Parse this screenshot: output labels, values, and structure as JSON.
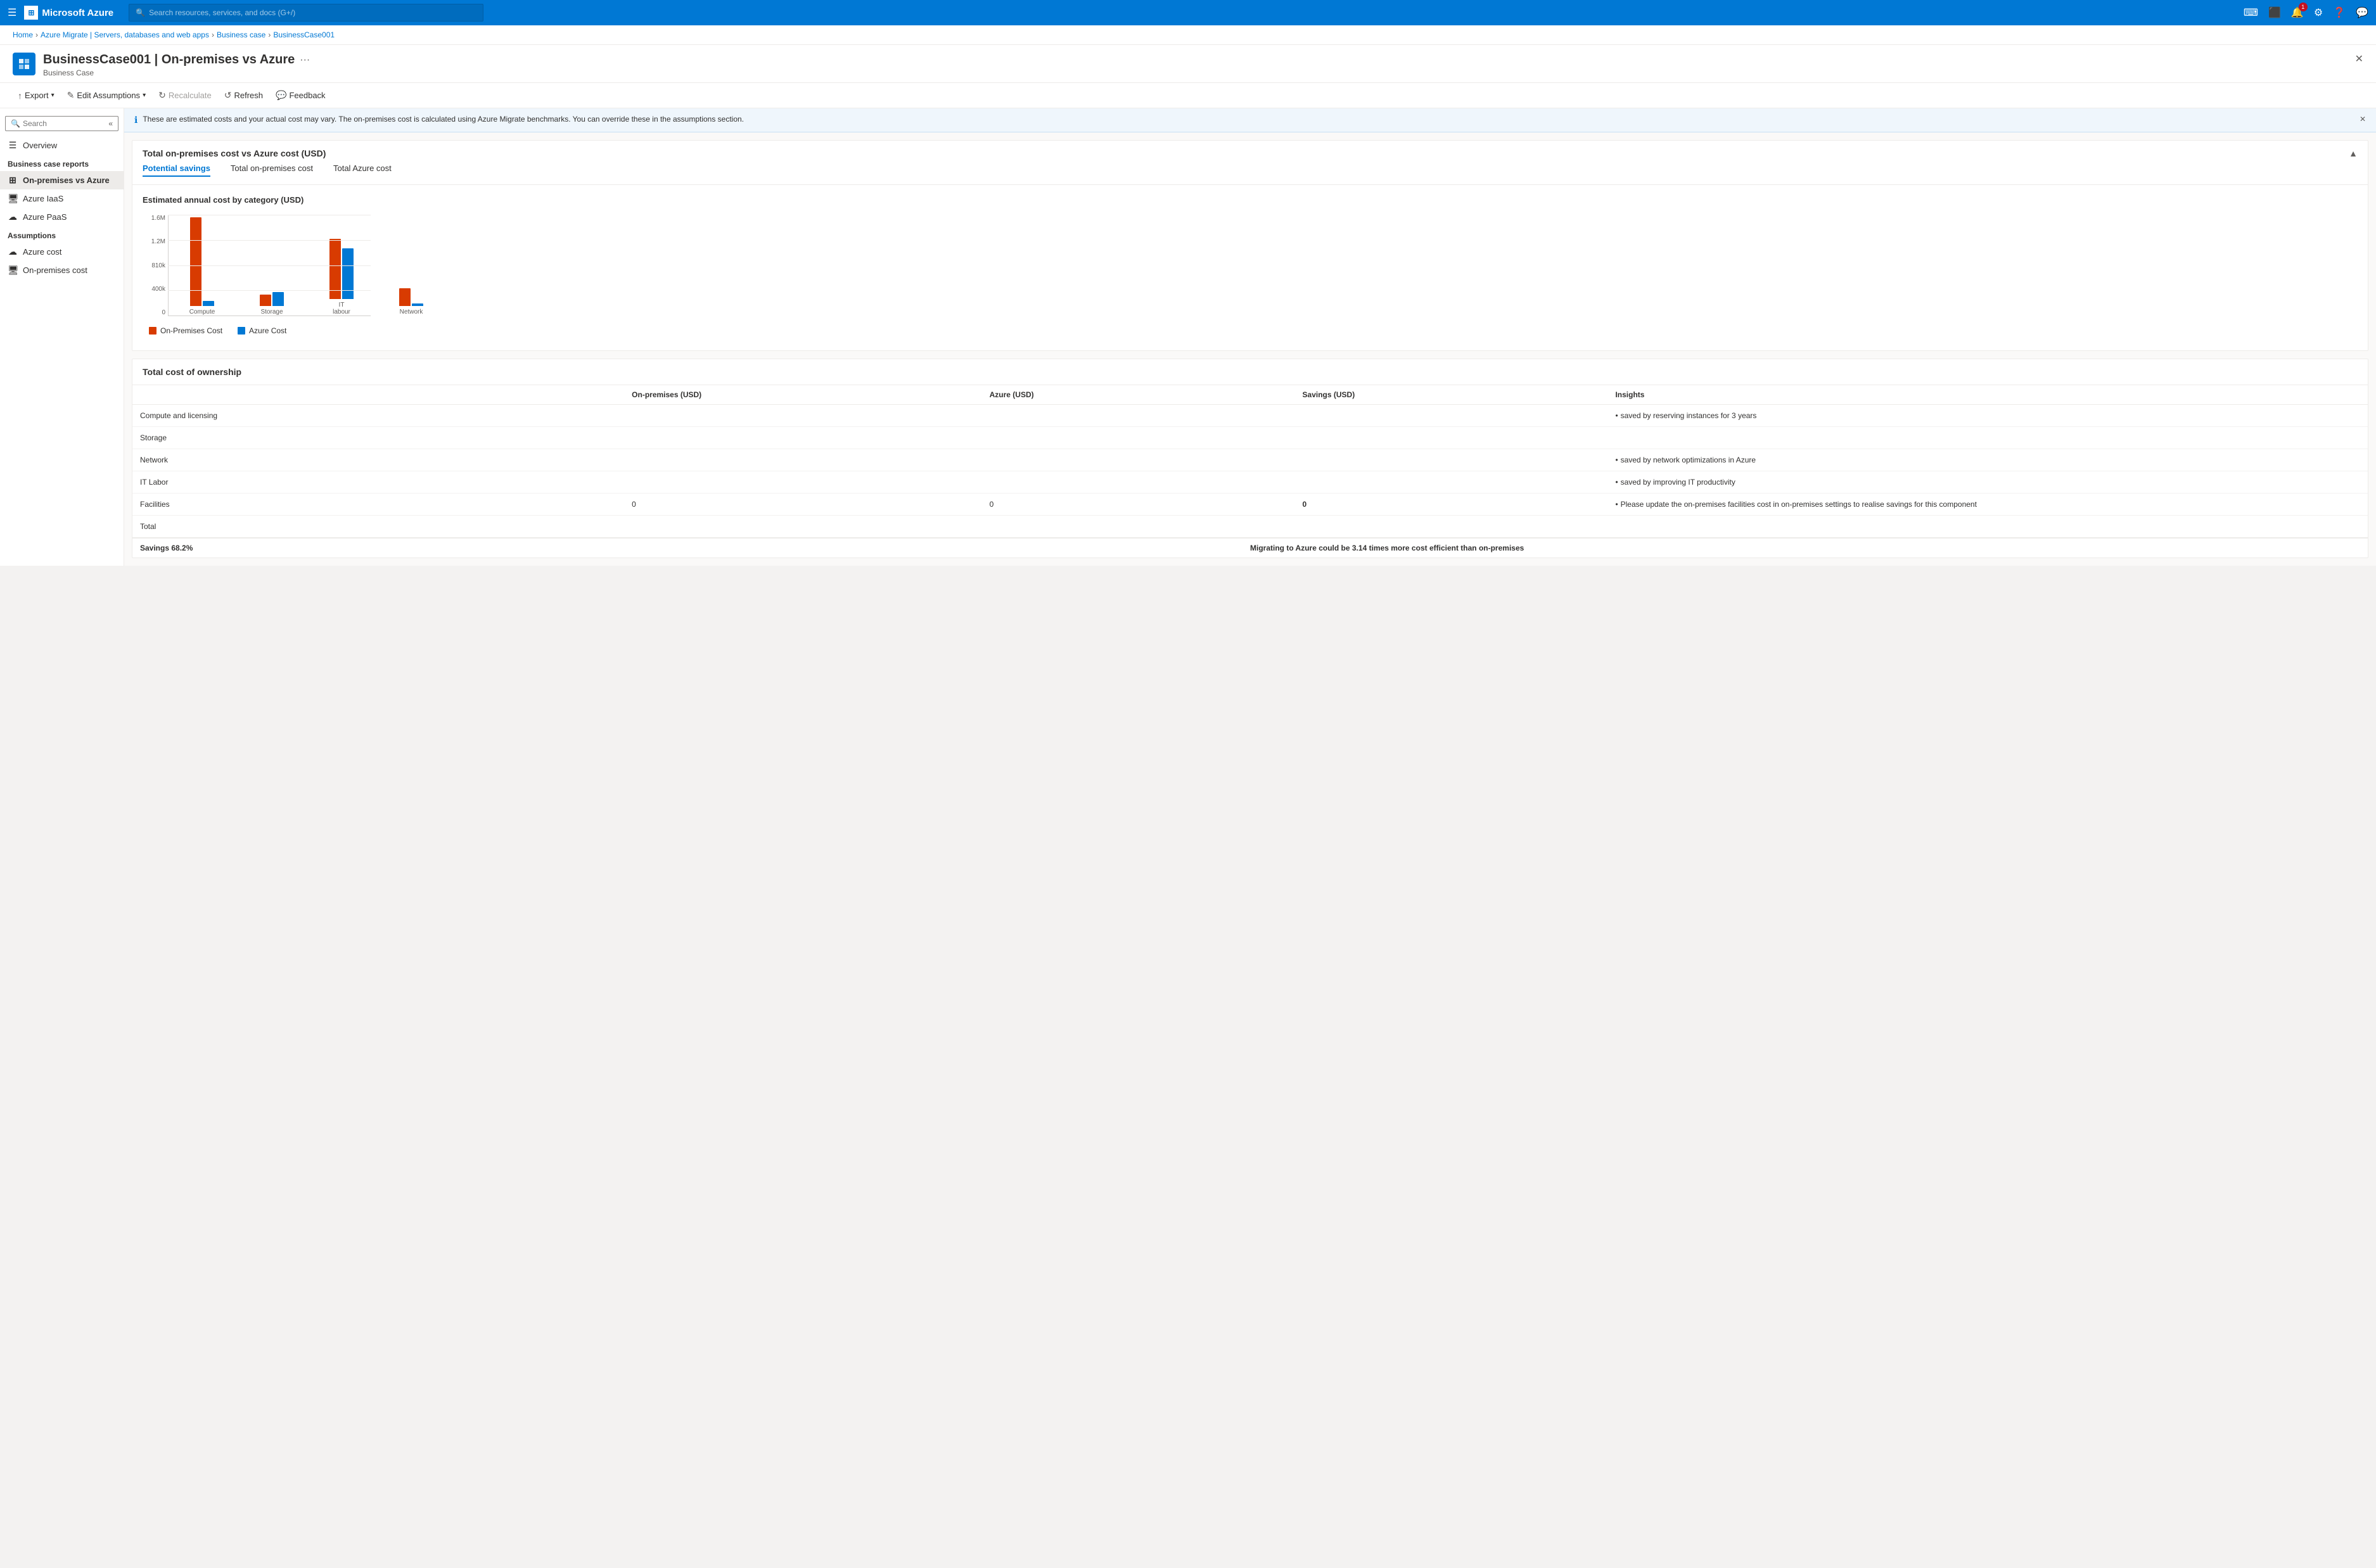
{
  "topBar": {
    "hamburger": "☰",
    "logo": "Microsoft Azure",
    "searchPlaceholder": "Search resources, services, and docs (G+/)",
    "icons": [
      "🖥",
      "⬆",
      "🔔",
      "⚙",
      "❓",
      "💬"
    ],
    "notificationBadge": "1"
  },
  "breadcrumb": {
    "items": [
      "Home",
      "Azure Migrate | Servers, databases and web apps",
      "Business case",
      "BusinessCase001"
    ]
  },
  "pageHeader": {
    "title": "BusinessCase001 | On-premises vs Azure",
    "subtitle": "Business Case",
    "icon": "📊"
  },
  "toolbar": {
    "export": "Export",
    "editAssumptions": "Edit Assumptions",
    "recalculate": "Recalculate",
    "refresh": "Refresh",
    "feedback": "Feedback"
  },
  "sidebar": {
    "searchPlaceholder": "Search",
    "overview": "Overview",
    "businessCaseReportsLabel": "Business case reports",
    "reports": [
      {
        "label": "On-premises vs Azure",
        "active": true
      },
      {
        "label": "Azure IaaS"
      },
      {
        "label": "Azure PaaS"
      }
    ],
    "assumptionsLabel": "Assumptions",
    "assumptions": [
      {
        "label": "Azure cost"
      },
      {
        "label": "On-premises cost"
      }
    ]
  },
  "infoBanner": {
    "text": "These are estimated costs and your actual cost may vary. The on-premises cost is calculated using Azure Migrate benchmarks. You can override these in the assumptions section."
  },
  "costSection": {
    "title": "Total on-premises cost vs Azure cost (USD)",
    "tabs": [
      "Potential savings",
      "Total on-premises cost",
      "Total Azure cost"
    ],
    "activeTab": 0
  },
  "chart": {
    "title": "Estimated annual cost by category (USD)",
    "yLabels": [
      "0",
      "400k",
      "810k",
      "1.2M",
      "1.6M"
    ],
    "groups": [
      {
        "label": "Compute",
        "onPremHeight": 140,
        "azureHeight": 8
      },
      {
        "label": "Storage",
        "onPremHeight": 18,
        "azureHeight": 22
      },
      {
        "label": "IT labour",
        "onPremHeight": 95,
        "azureHeight": 80
      },
      {
        "label": "Network",
        "onPremHeight": 28,
        "azureHeight": 4
      }
    ],
    "legend": {
      "onPremLabel": "On-Premises Cost",
      "azureLabel": "Azure Cost"
    }
  },
  "tcoSection": {
    "title": "Total cost of ownership",
    "headers": [
      "",
      "On-premises (USD)",
      "Azure (USD)",
      "Savings (USD)",
      "Insights"
    ],
    "rows": [
      {
        "category": "Compute and licensing",
        "onPrem": "",
        "azure": "",
        "savings": "",
        "insight": "saved by reserving instances for 3 years"
      },
      {
        "category": "Storage",
        "onPrem": "",
        "azure": "",
        "savings": "",
        "insight": ""
      },
      {
        "category": "Network",
        "onPrem": "",
        "azure": "",
        "savings": "",
        "insight": "saved by network optimizations in Azure"
      },
      {
        "category": "IT Labor",
        "onPrem": "",
        "azure": "",
        "savings": "",
        "insight": "saved by improving IT productivity"
      },
      {
        "category": "Facilities",
        "onPrem": "0",
        "azure": "0",
        "savings": "0",
        "insight": "Please update the on-premises facilities cost in on-premises settings to realise savings for this component"
      },
      {
        "category": "Total",
        "onPrem": "",
        "azure": "",
        "savings": "",
        "insight": ""
      }
    ],
    "savingsLabel": "Savings 68.2%",
    "migrationLabel": "Migrating to Azure could be 3.14 times more cost efficient than on-premises"
  }
}
